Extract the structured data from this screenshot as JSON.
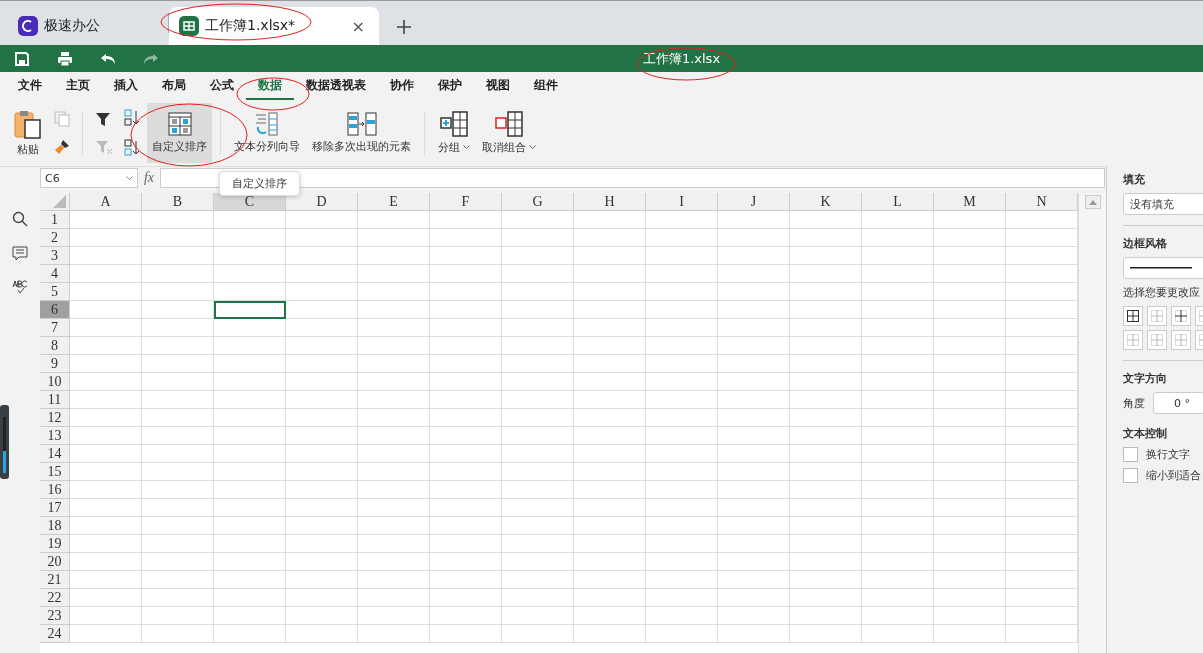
{
  "tabs": [
    {
      "label": "极速办公",
      "kind": "home",
      "selected": false
    },
    {
      "label": "工作簿1.xlsx*",
      "kind": "sheet",
      "selected": true,
      "close": "×"
    }
  ],
  "quick_actions": [
    {
      "kind": "save",
      "disabled": false
    },
    {
      "kind": "print",
      "disabled": false
    },
    {
      "kind": "undo",
      "disabled": false
    },
    {
      "kind": "redo",
      "disabled": true
    }
  ],
  "title": "工作簿1.xlsx",
  "menu": [
    {
      "label": "文件",
      "selected": false
    },
    {
      "label": "主页",
      "selected": false
    },
    {
      "label": "插入",
      "selected": false
    },
    {
      "label": "布局",
      "selected": false
    },
    {
      "label": "公式",
      "selected": false
    },
    {
      "label": "数据",
      "selected": true
    },
    {
      "label": "数据透视表",
      "selected": false
    },
    {
      "label": "协作",
      "selected": false
    },
    {
      "label": "保护",
      "selected": false
    },
    {
      "label": "视图",
      "selected": false
    },
    {
      "label": "组件",
      "selected": false
    }
  ],
  "ribbon_groups": [
    {
      "tools": [
        {
          "kind": "paste",
          "label": "粘贴",
          "highlighted": false,
          "dropdown": false
        },
        {
          "kind": "stack",
          "tools": [
            {
              "kind": "copy",
              "disabled": true
            },
            {
              "kind": "brush",
              "disabled": false
            }
          ]
        }
      ]
    },
    {
      "tools": [
        {
          "kind": "stack",
          "tools": [
            {
              "kind": "filter",
              "disabled": false
            },
            {
              "kind": "clear-filter",
              "disabled": true
            }
          ]
        },
        {
          "kind": "stack",
          "tools": [
            {
              "kind": "sort-asc",
              "disabled": false
            },
            {
              "kind": "sort-desc",
              "disabled": false
            }
          ]
        },
        {
          "kind": "custom-sort",
          "label": "自定义排序",
          "highlighted": true,
          "dropdown": false
        }
      ]
    },
    {
      "tools": [
        {
          "kind": "split",
          "label": "文本分列向导",
          "highlighted": false,
          "dropdown": false
        },
        {
          "kind": "dedupe",
          "label": "移除多次出现的元素",
          "highlighted": false,
          "dropdown": false
        }
      ]
    },
    {
      "tools": [
        {
          "kind": "group",
          "label": "分组",
          "highlighted": false,
          "dropdown": true
        },
        {
          "kind": "ungroup",
          "label": "取消组合",
          "highlighted": false,
          "dropdown": true
        }
      ]
    }
  ],
  "tooltip": "自定义排序",
  "formula_bar": {
    "cell_ref": "C6",
    "fx": "fx"
  },
  "sheet": {
    "columns": [
      {
        "label": "A",
        "selected": false
      },
      {
        "label": "B",
        "selected": false
      },
      {
        "label": "C",
        "selected": true
      },
      {
        "label": "D",
        "selected": false
      },
      {
        "label": "E",
        "selected": false
      },
      {
        "label": "F",
        "selected": false
      },
      {
        "label": "G",
        "selected": false
      },
      {
        "label": "H",
        "selected": false
      },
      {
        "label": "I",
        "selected": false
      },
      {
        "label": "J",
        "selected": false
      },
      {
        "label": "K",
        "selected": false
      },
      {
        "label": "L",
        "selected": false
      },
      {
        "label": "M",
        "selected": false
      },
      {
        "label": "N",
        "selected": false
      }
    ],
    "rows": [
      {
        "label": "1",
        "selected": false
      },
      {
        "label": "2",
        "selected": false
      },
      {
        "label": "3",
        "selected": false
      },
      {
        "label": "4",
        "selected": false
      },
      {
        "label": "5",
        "selected": false
      },
      {
        "label": "6",
        "selected": true
      },
      {
        "label": "7",
        "selected": false
      },
      {
        "label": "8",
        "selected": false
      },
      {
        "label": "9",
        "selected": false
      },
      {
        "label": "10",
        "selected": false
      },
      {
        "label": "11",
        "selected": false
      },
      {
        "label": "12",
        "selected": false
      },
      {
        "label": "13",
        "selected": false
      },
      {
        "label": "14",
        "selected": false
      },
      {
        "label": "15",
        "selected": false
      },
      {
        "label": "16",
        "selected": false
      },
      {
        "label": "17",
        "selected": false
      },
      {
        "label": "18",
        "selected": false
      },
      {
        "label": "19",
        "selected": false
      },
      {
        "label": "20",
        "selected": false
      },
      {
        "label": "21",
        "selected": false
      },
      {
        "label": "22",
        "selected": false
      },
      {
        "label": "23",
        "selected": false
      },
      {
        "label": "24",
        "selected": false
      }
    ]
  },
  "format_panel": {
    "fill_heading": "填充",
    "fill_value": "没有填充",
    "border_heading": "边框风格",
    "border_hint": "选择您要更改应",
    "direction_heading": "文字方向",
    "angle_label": "角度",
    "angle_value": "0 °",
    "control_heading": "文本控制",
    "options": [
      {
        "label": "换行文字",
        "checked": false
      },
      {
        "label": "缩小到适合",
        "checked": false
      }
    ]
  }
}
